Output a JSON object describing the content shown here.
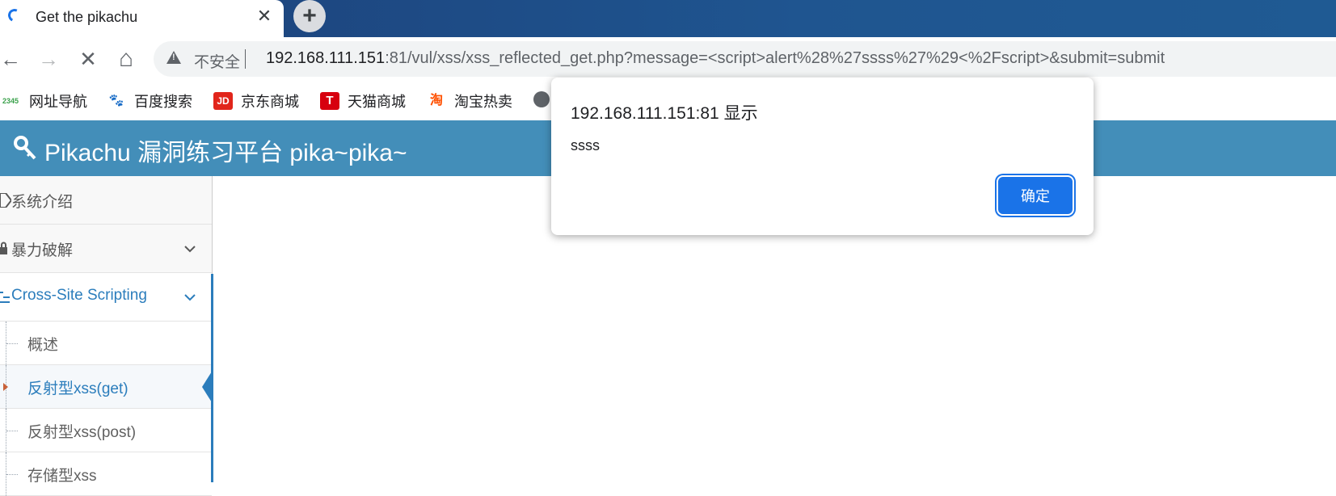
{
  "browser": {
    "tab": {
      "title": "Get the pikachu",
      "close_glyph": "✕",
      "loading": true
    },
    "new_tab_glyph": "+",
    "nav": {
      "back": "←",
      "forward": "→",
      "stop": "✕",
      "home": "⌂"
    },
    "omnibox": {
      "security_label": "不安全",
      "url_host": "192.168.111.151",
      "url_rest": ":81/vul/xss/xss_reflected_get.php?message=<script>alert%28%27ssss%27%29<%2Fscript>&submit=submit"
    },
    "bookmarks": [
      {
        "label": "网址导航",
        "icon": "2345-icon",
        "icon_text": "2345",
        "color": "#3aa14b"
      },
      {
        "label": "百度搜索",
        "icon": "baidu-paw-icon",
        "icon_text": "🐾",
        "color": "#2932e1"
      },
      {
        "label": "京东商城",
        "icon": "jd-icon",
        "icon_text": "JD",
        "color": "#e1251b"
      },
      {
        "label": "天猫商城",
        "icon": "tmall-icon",
        "icon_text": "T",
        "color": "#d7000f"
      },
      {
        "label": "淘宝热卖",
        "icon": "taobao-icon",
        "icon_text": "淘",
        "color": "#ff5000"
      },
      {
        "label": "",
        "icon": "globe-icon",
        "icon_text": "",
        "color": "#5f6368"
      }
    ]
  },
  "page": {
    "header": {
      "title": "Pikachu 漏洞练习平台 pika~pika~",
      "accent": "#438eb9"
    },
    "sidebar": {
      "items": [
        {
          "label": "系统介绍",
          "icon": "tag-icon"
        },
        {
          "label": "暴力破解",
          "icon": "lock-icon",
          "expandable": true
        },
        {
          "label": "Cross-Site Scripting",
          "icon": "list-icon",
          "expandable": true,
          "active": true
        }
      ],
      "sub_items": [
        {
          "label": "概述"
        },
        {
          "label": "反射型xss(get)",
          "selected": true
        },
        {
          "label": "反射型xss(post)"
        },
        {
          "label": "存储型xss"
        }
      ],
      "active_color": "#2b7dbc"
    }
  },
  "dialog": {
    "title": "192.168.111.151:81 显示",
    "message": "ssss",
    "ok_label": "确定",
    "button_color": "#1a73e8"
  }
}
